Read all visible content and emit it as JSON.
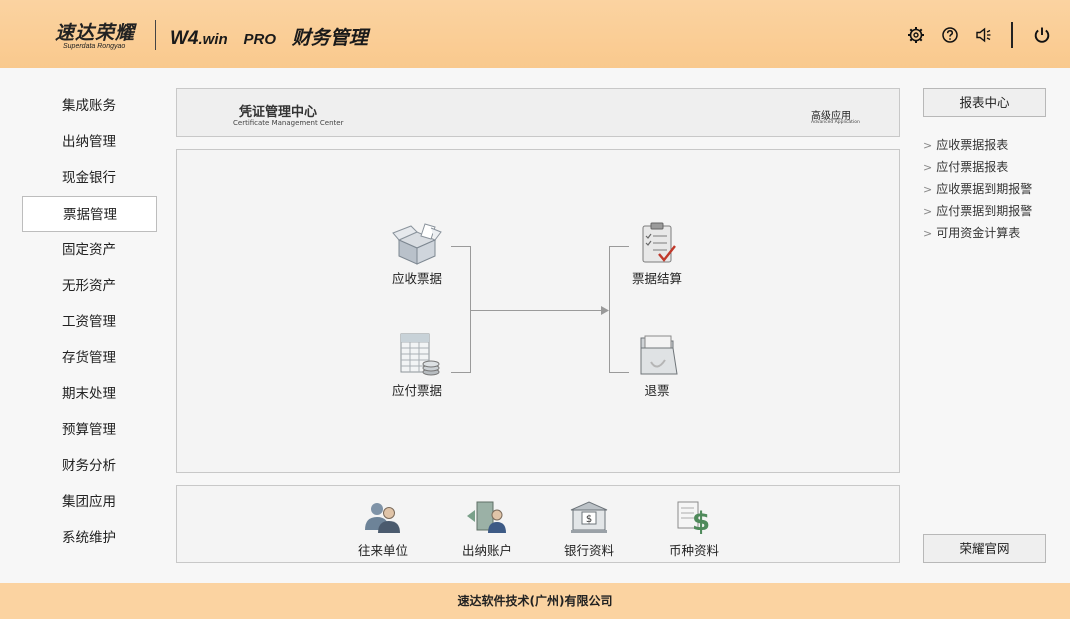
{
  "header": {
    "logo_main": "速达荣耀",
    "logo_sub": "Superdata Rongyao",
    "app_title_prefix": "W4",
    "app_title_suffix": ".win",
    "app_title_pro": "PRO",
    "app_title_name": "财务管理",
    "icons": [
      "gear-icon",
      "help-icon",
      "speaker-icon",
      "power-icon"
    ]
  },
  "sidebar": {
    "items": [
      {
        "label": "集成账务"
      },
      {
        "label": "出纳管理"
      },
      {
        "label": "现金银行"
      },
      {
        "label": "票据管理",
        "active": true
      },
      {
        "label": "固定资产"
      },
      {
        "label": "无形资产"
      },
      {
        "label": "工资管理"
      },
      {
        "label": "存货管理"
      },
      {
        "label": "期末处理"
      },
      {
        "label": "预算管理"
      },
      {
        "label": "财务分析"
      },
      {
        "label": "集团应用"
      },
      {
        "label": "系统维护"
      }
    ]
  },
  "title_bar": {
    "title": "凭证管理中心",
    "subtitle": "Certificate Management Center",
    "advanced": "高级应用",
    "advanced_sub": "Advanced Application"
  },
  "flow": {
    "receivable": "应收票据",
    "payable": "应付票据",
    "settle": "票据结算",
    "refund": "退票"
  },
  "toolbar": {
    "contacts": "往来单位",
    "cashier_account": "出纳账户",
    "bank_info": "银行资料",
    "currency_info": "币种资料"
  },
  "reports": {
    "center_button": "报表中心",
    "items": [
      "应收票据报表",
      "应付票据报表",
      "应收票据到期报警",
      "应付票据到期报警",
      "可用资金计算表"
    ],
    "site_button": "荣耀官网"
  },
  "footer": {
    "company": "速达软件技术(广州)有限公司"
  },
  "colors": {
    "header_bg": "#f9c98d",
    "footer_bg": "#fbd3a1"
  }
}
